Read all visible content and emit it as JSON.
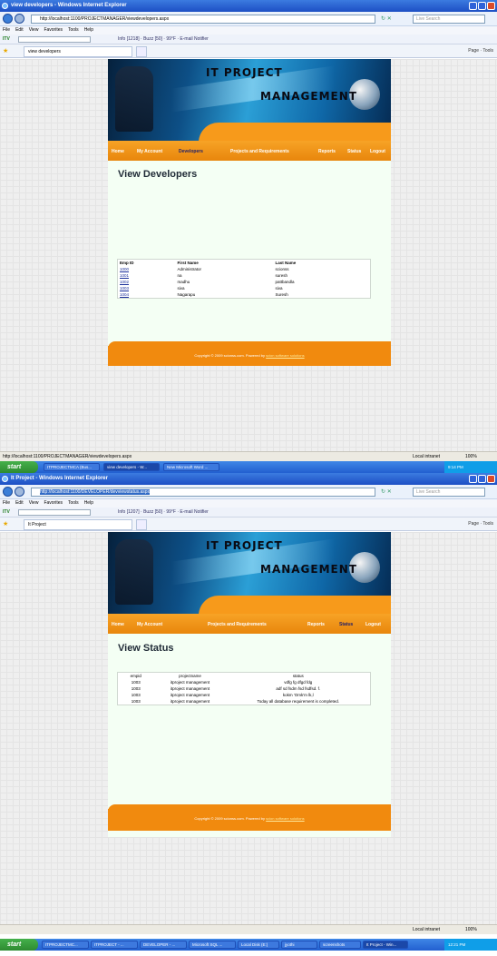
{
  "shot1": {
    "window_title": "view developers - Windows Internet Explorer",
    "address": "http://localhost:1100/PROJECTMANAGER/viewdevelopers.aspx",
    "live_search_placeholder": "Live Search",
    "menu": [
      "File",
      "Edit",
      "View",
      "Favorites",
      "Tools",
      "Help"
    ],
    "toolbar_brand": "ITV",
    "toolbar_text": "Info [1218] · Buzz [50] · 99°F · E-mail Notifier",
    "tab_title": "view developers",
    "command_bar": "Page · Tools",
    "site": {
      "banner_line1": "IT PROJECT",
      "banner_line2": "MANAGEMENT",
      "nav": [
        "Home",
        "My Account",
        "Developers",
        "Projects and Requirements",
        "Reports",
        "Status",
        "Logout"
      ],
      "page_title": "View Developers",
      "columns": [
        "Emp ID",
        "First Name",
        "Last Name"
      ],
      "rows": [
        [
          "1000",
          "Administrator",
          "scionss"
        ],
        [
          "1001",
          "na",
          "suresh"
        ],
        [
          "1002",
          "madhu",
          "pattbandla"
        ],
        [
          "1003",
          "siva",
          "siva"
        ],
        [
          "1004",
          "Nagarapu",
          "Suresh"
        ]
      ],
      "footer_text": "Copyright © 2009 scionss.com. Powered by",
      "footer_link": "scion software solutions"
    },
    "status_text": "http://localhost:1100/PROJECTMANAGER/viewdevelopers.aspx",
    "zone": "Local intranet",
    "zoom": "100%",
    "taskbar": {
      "start": "start",
      "tasks": [
        "ITPROJECTMCA (Bus...",
        "view developers - W...",
        "New Microsoft Word ..."
      ],
      "clock": "9:14 PM"
    }
  },
  "shot2": {
    "window_title": "It Project - Windows Internet Explorer",
    "address": "http://localhost:1100/DEVELOPER/devviewstatus.aspx",
    "live_search_placeholder": "Live Search",
    "menu": [
      "File",
      "Edit",
      "View",
      "Favorites",
      "Tools",
      "Help"
    ],
    "toolbar_brand": "ITV",
    "toolbar_text": "Info [1207] · Buzz [50] · 99°F · E-mail Notifier",
    "tab_title": "It Project",
    "command_bar": "Page · Tools",
    "site": {
      "banner_line1": "IT PROJECT",
      "banner_line2": "MANAGEMENT",
      "nav": [
        "Home",
        "My Account",
        "Projects and Requirements",
        "Reports",
        "Status",
        "Logout"
      ],
      "page_title": "View Status",
      "columns": [
        "empid",
        "projectname",
        "status"
      ],
      "rows": [
        [
          "1003",
          "itproject management",
          "vdfg fg dfgd fdg"
        ],
        [
          "1003",
          "itproject management",
          "adf sd fsdm fsd fsdfsd. f."
        ],
        [
          "1003",
          "itproject management",
          "kokm 'Omk'm lk,l"
        ],
        [
          "1003",
          "itproject management",
          "Today all database requirement is completed."
        ]
      ],
      "footer_text": "Copyright © 2009 scionss.com. Powered by",
      "footer_link": "scion software solutions"
    },
    "zone": "Local intranet",
    "zoom": "100%",
    "taskbar": {
      "start": "start",
      "tasks": [
        "ITPROJECTMC...",
        "ITPROJECT - ...",
        "DEVELOPER - ...",
        "Microsoft SQL ...",
        "Local Disk (E:)",
        "jyothi",
        "screenshots",
        "It Project - Win..."
      ],
      "clock": "12:21 PM"
    }
  }
}
